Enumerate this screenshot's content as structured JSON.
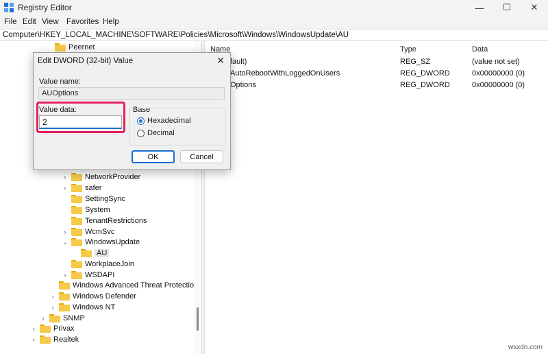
{
  "window": {
    "title": "Registry Editor",
    "minimize": "—",
    "maximize": "☐",
    "close": "✕"
  },
  "menu": [
    "File",
    "Edit",
    "View",
    "Favorites",
    "Help"
  ],
  "address": "Computer\\HKEY_LOCAL_MACHINE\\SOFTWARE\\Policies\\Microsoft\\Windows\\WindowsUpdate\\AU",
  "tree": [
    {
      "label": "Peernet",
      "chev": ""
    },
    {
      "label": "NetworkProvider",
      "chev": "›"
    },
    {
      "label": "safer",
      "chev": "›"
    },
    {
      "label": "SettingSync",
      "chev": ""
    },
    {
      "label": "System",
      "chev": ""
    },
    {
      "label": "TenantRestrictions",
      "chev": ""
    },
    {
      "label": "WcmSvc",
      "chev": "›"
    },
    {
      "label": "WindowsUpdate",
      "chev": "⌄"
    },
    {
      "label": "AU",
      "chev": ""
    },
    {
      "label": "WorkplaceJoin",
      "chev": ""
    },
    {
      "label": "WSDAPI",
      "chev": "›"
    },
    {
      "label": "Windows Advanced Threat Protection",
      "chev": ""
    },
    {
      "label": "Windows Defender",
      "chev": "›"
    },
    {
      "label": "Windows NT",
      "chev": "›"
    },
    {
      "label": "SNMP",
      "chev": "›"
    },
    {
      "label": "Privax",
      "chev": "›"
    },
    {
      "label": "Realtek",
      "chev": "›"
    }
  ],
  "list": {
    "columns": [
      "Name",
      "Type",
      "Data"
    ],
    "rows": [
      {
        "name": "fault)",
        "type": "REG_SZ",
        "data": "(value not set)"
      },
      {
        "name": "AutoRebootWithLoggedOnUsers",
        "type": "REG_DWORD",
        "data": "0x00000000 (0)"
      },
      {
        "name": "Options",
        "type": "REG_DWORD",
        "data": "0x00000000 (0)"
      }
    ]
  },
  "dialog": {
    "title": "Edit DWORD (32-bit) Value",
    "close": "✕",
    "value_name_label": "Value name:",
    "value_name": "AUOptions",
    "value_data_label": "Value data:",
    "value_data": "2",
    "base_label": "Base",
    "hex_label": "Hexadecimal",
    "dec_label": "Decimal",
    "ok": "OK",
    "cancel": "Cancel"
  },
  "watermark": "wsxdn.com"
}
